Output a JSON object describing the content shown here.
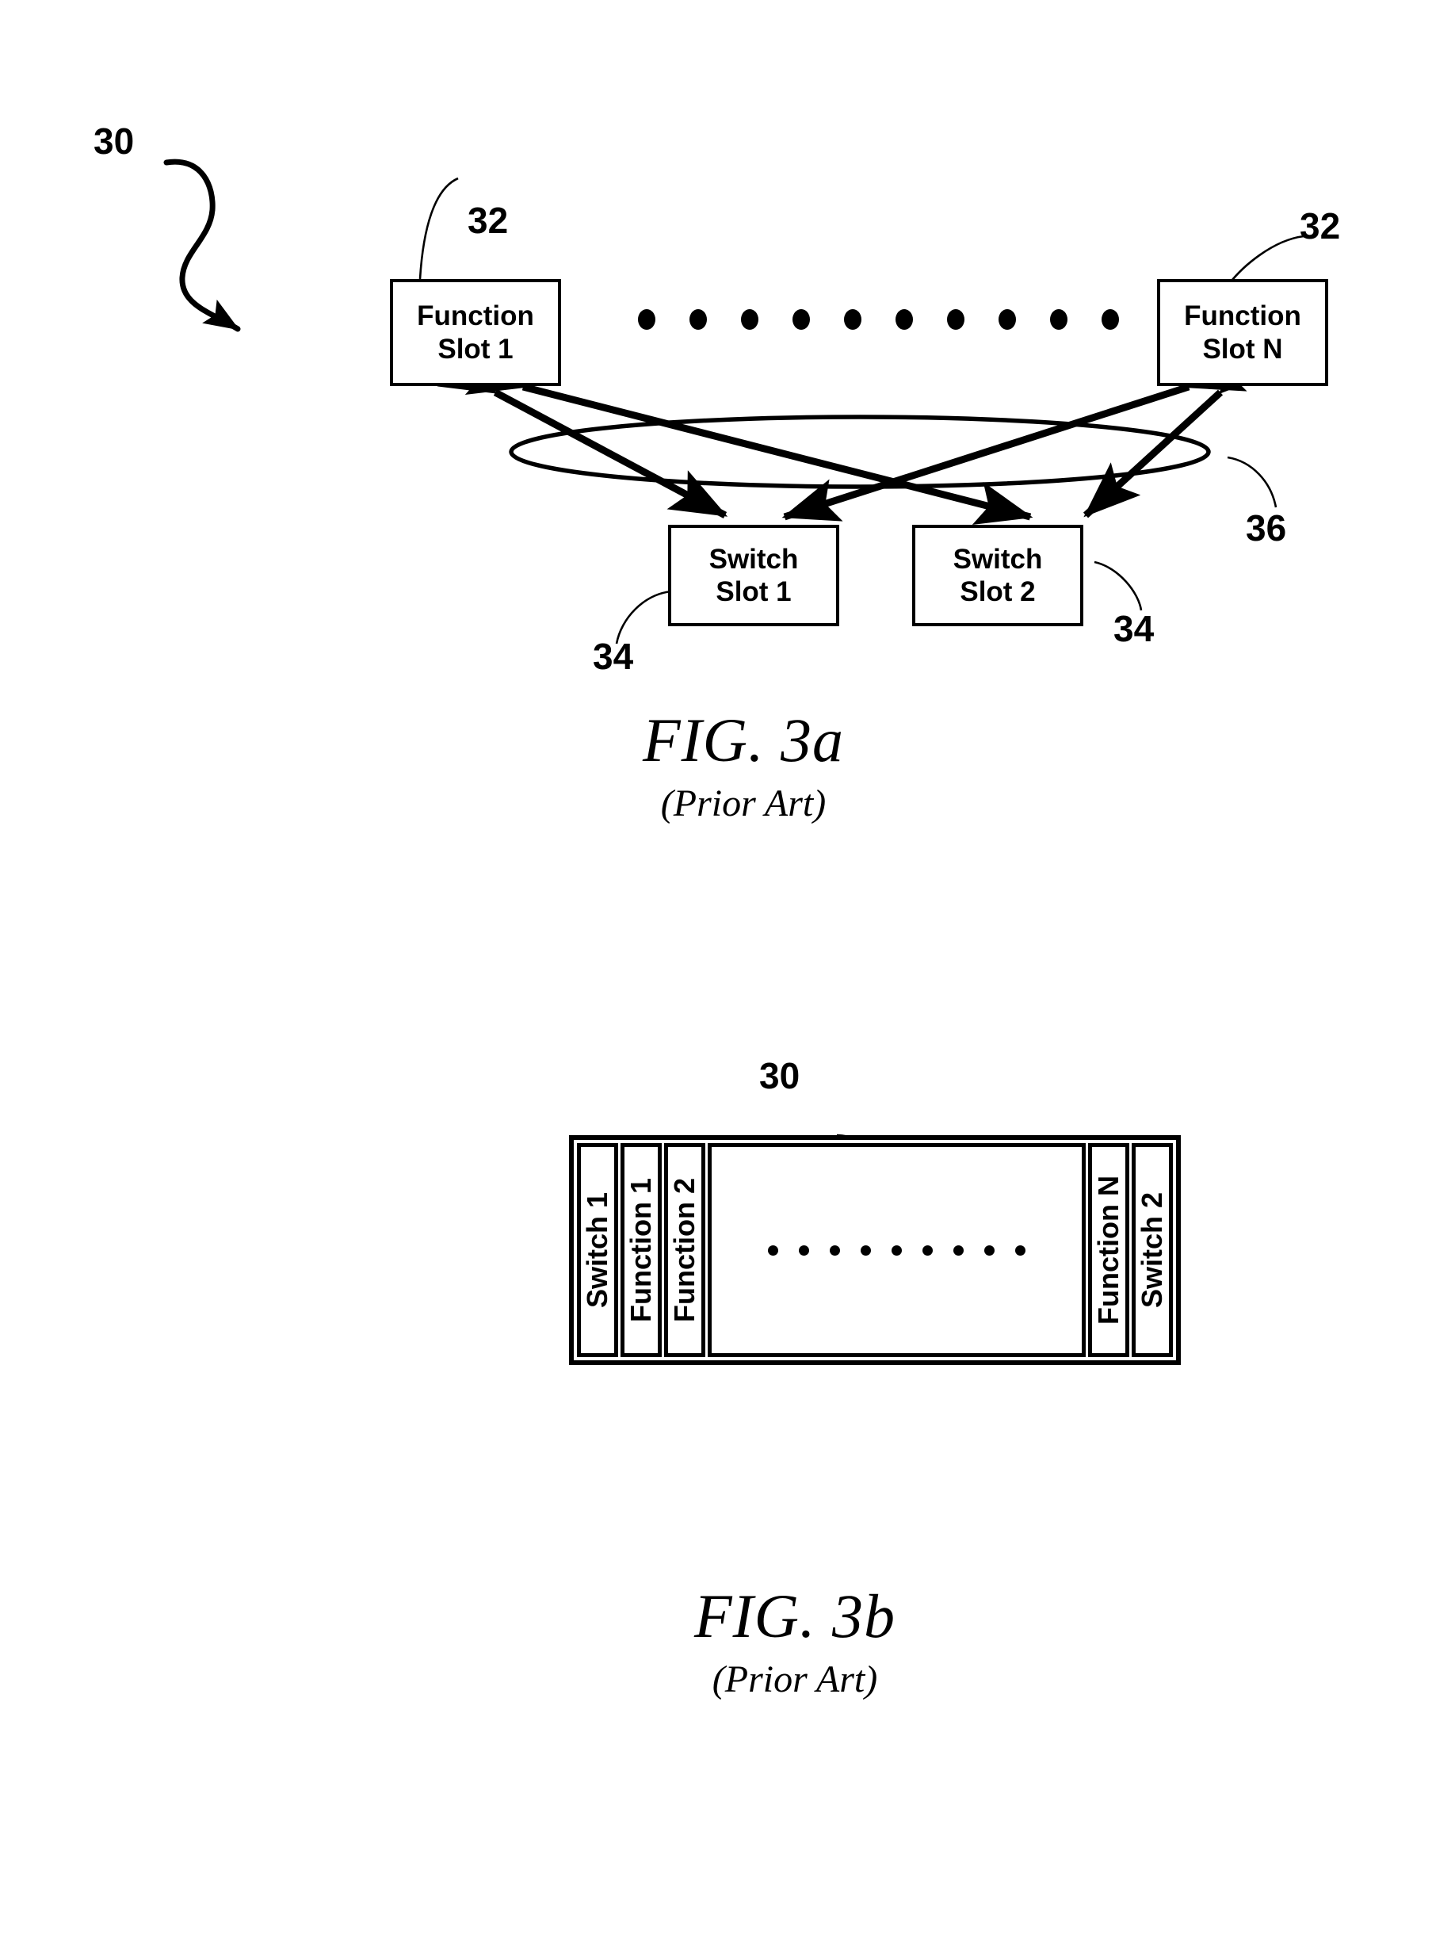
{
  "document": {
    "type": "patent-drawing-sheet",
    "figures": [
      {
        "id": "fig3a",
        "caption_title": "FIG. 3a",
        "caption_subtitle": "(Prior Art)",
        "overall_ref": "30",
        "ellipse_ref": "36",
        "boxes": [
          {
            "ref": "32",
            "line1": "Function",
            "line2": "Slot 1"
          },
          {
            "ref": "32",
            "line1": "Function",
            "line2": "Slot N"
          },
          {
            "ref": "34",
            "line1": "Switch",
            "line2": "Slot 1"
          },
          {
            "ref": "34",
            "line1": "Switch",
            "line2": "Slot 2"
          }
        ],
        "ellipsis_dot_count": 10
      },
      {
        "id": "fig3b",
        "caption_title": "FIG. 3b",
        "caption_subtitle": "(Prior Art)",
        "overall_ref": "30",
        "cards_left": [
          "Switch 1",
          "Function 1",
          "Function 2"
        ],
        "cards_right": [
          "Function N",
          "Switch 2"
        ],
        "ellipsis_dot_count": 9
      }
    ]
  },
  "fig3a": {
    "ref_30": "30",
    "ref_32_left": "32",
    "ref_32_right": "32",
    "ref_34_left": "34",
    "ref_34_right": "34",
    "ref_36": "36",
    "box_function1_line1": "Function",
    "box_function1_line2": "Slot 1",
    "box_functionN_line1": "Function",
    "box_functionN_line2": "Slot N",
    "box_switch1_line1": "Switch",
    "box_switch1_line2": "Slot 1",
    "box_switch2_line1": "Switch",
    "box_switch2_line2": "Slot 2",
    "caption_title": "FIG. 3a",
    "caption_subtitle": "(Prior Art)"
  },
  "fig3b": {
    "ref_30": "30",
    "card_switch1": "Switch 1",
    "card_function1": "Function 1",
    "card_function2": "Function 2",
    "card_functionN": "Function N",
    "card_switch2": "Switch 2",
    "caption_title": "FIG. 3b",
    "caption_subtitle": "(Prior Art)"
  },
  "colors": {
    "ink": "#000000",
    "paper": "#ffffff"
  }
}
